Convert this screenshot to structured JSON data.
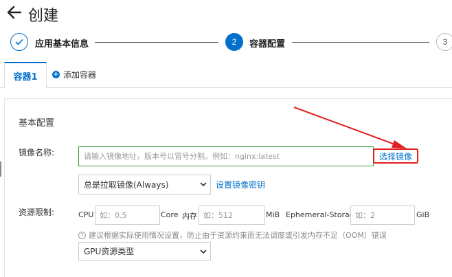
{
  "header": {
    "title": "创建"
  },
  "steps": [
    {
      "number": "✓",
      "label": "应用基本信息"
    },
    {
      "number": "2",
      "label": "容器配置"
    },
    {
      "number": "3",
      "label": ""
    }
  ],
  "tabs": {
    "active_label": "容器1",
    "add_label": "添加容器"
  },
  "basic_config": {
    "title": "基本配置",
    "image_label": "镜像名称:",
    "image_placeholder": "请输入镜像地址，版本号以冒号分割。例如：nginx:latest",
    "select_image_label": "选择镜像",
    "pull_policy_value": "总是拉取镜像(Always)",
    "secret_link": "设置镜像密钥"
  },
  "resources": {
    "label": "资源限制:",
    "cpu_label": "CPU",
    "cpu_placeholder": "如：0.5",
    "cpu_unit": "Core",
    "mem_label": "内存",
    "mem_placeholder": "如：512",
    "mem_unit": "MiB",
    "eph_label": "Ephemeral-Storage",
    "eph_placeholder": "如：2",
    "eph_unit": "GiB",
    "hint": "建议根据实际使用情况设置，防止由于资源约束而无法调度或引发内存不足（OOM）错误",
    "gpu_select_value": "GPU资源类型"
  },
  "colors": {
    "accent": "#0070cc",
    "highlight": "#e02020",
    "input_focus": "#3a9a3a"
  },
  "icons": {
    "back": "arrow-left-icon",
    "check": "check-icon",
    "add": "plus-circle-icon",
    "help": "question-icon",
    "dropdown": "chevron-down-icon"
  }
}
